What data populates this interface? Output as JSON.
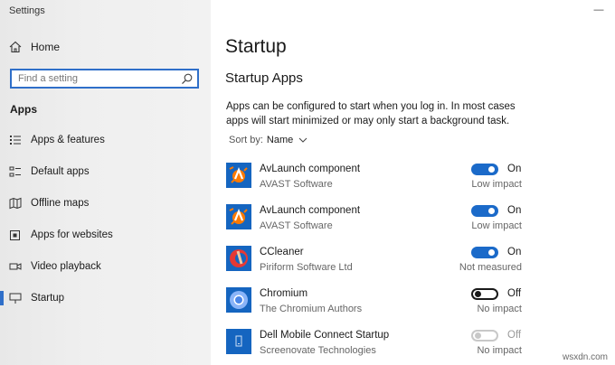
{
  "window": {
    "title": "Settings",
    "minimize_glyph": "—"
  },
  "sidebar": {
    "home_label": "Home",
    "search_placeholder": "Find a setting",
    "section_title": "Apps",
    "items": [
      {
        "label": "Apps & features",
        "icon": "list-icon"
      },
      {
        "label": "Default apps",
        "icon": "default-apps-icon"
      },
      {
        "label": "Offline maps",
        "icon": "map-icon"
      },
      {
        "label": "Apps for websites",
        "icon": "link-out-icon"
      },
      {
        "label": "Video playback",
        "icon": "video-icon"
      },
      {
        "label": "Startup",
        "icon": "startup-icon",
        "active": true
      }
    ]
  },
  "main": {
    "title": "Startup",
    "subtitle": "Startup Apps",
    "description": "Apps can be configured to start when you log in. In most cases apps will start minimized or may only start a background task.",
    "sort_label": "Sort by:",
    "sort_value": "Name",
    "apps": [
      {
        "name": "AvLaunch component",
        "publisher": "AVAST Software",
        "state": "On",
        "enabled": true,
        "impact": "Low impact",
        "icon": "avast-icon"
      },
      {
        "name": "AvLaunch component",
        "publisher": "AVAST Software",
        "state": "On",
        "enabled": true,
        "impact": "Low impact",
        "icon": "avast-icon"
      },
      {
        "name": "CCleaner",
        "publisher": "Piriform Software Ltd",
        "state": "On",
        "enabled": true,
        "impact": "Not measured",
        "icon": "ccleaner-icon"
      },
      {
        "name": "Chromium",
        "publisher": "The Chromium Authors",
        "state": "Off",
        "enabled": false,
        "impact": "No impact",
        "icon": "chromium-icon"
      },
      {
        "name": "Dell Mobile Connect Startup",
        "publisher": "Screenovate Technologies",
        "state": "Off",
        "enabled": false,
        "impact": "No impact",
        "icon": "dell-mobile-connect-icon",
        "disabled": true
      }
    ]
  },
  "watermark": "wsxdn.com",
  "colors": {
    "accent": "#1b6ac9",
    "search_border": "#2f6fc9"
  }
}
